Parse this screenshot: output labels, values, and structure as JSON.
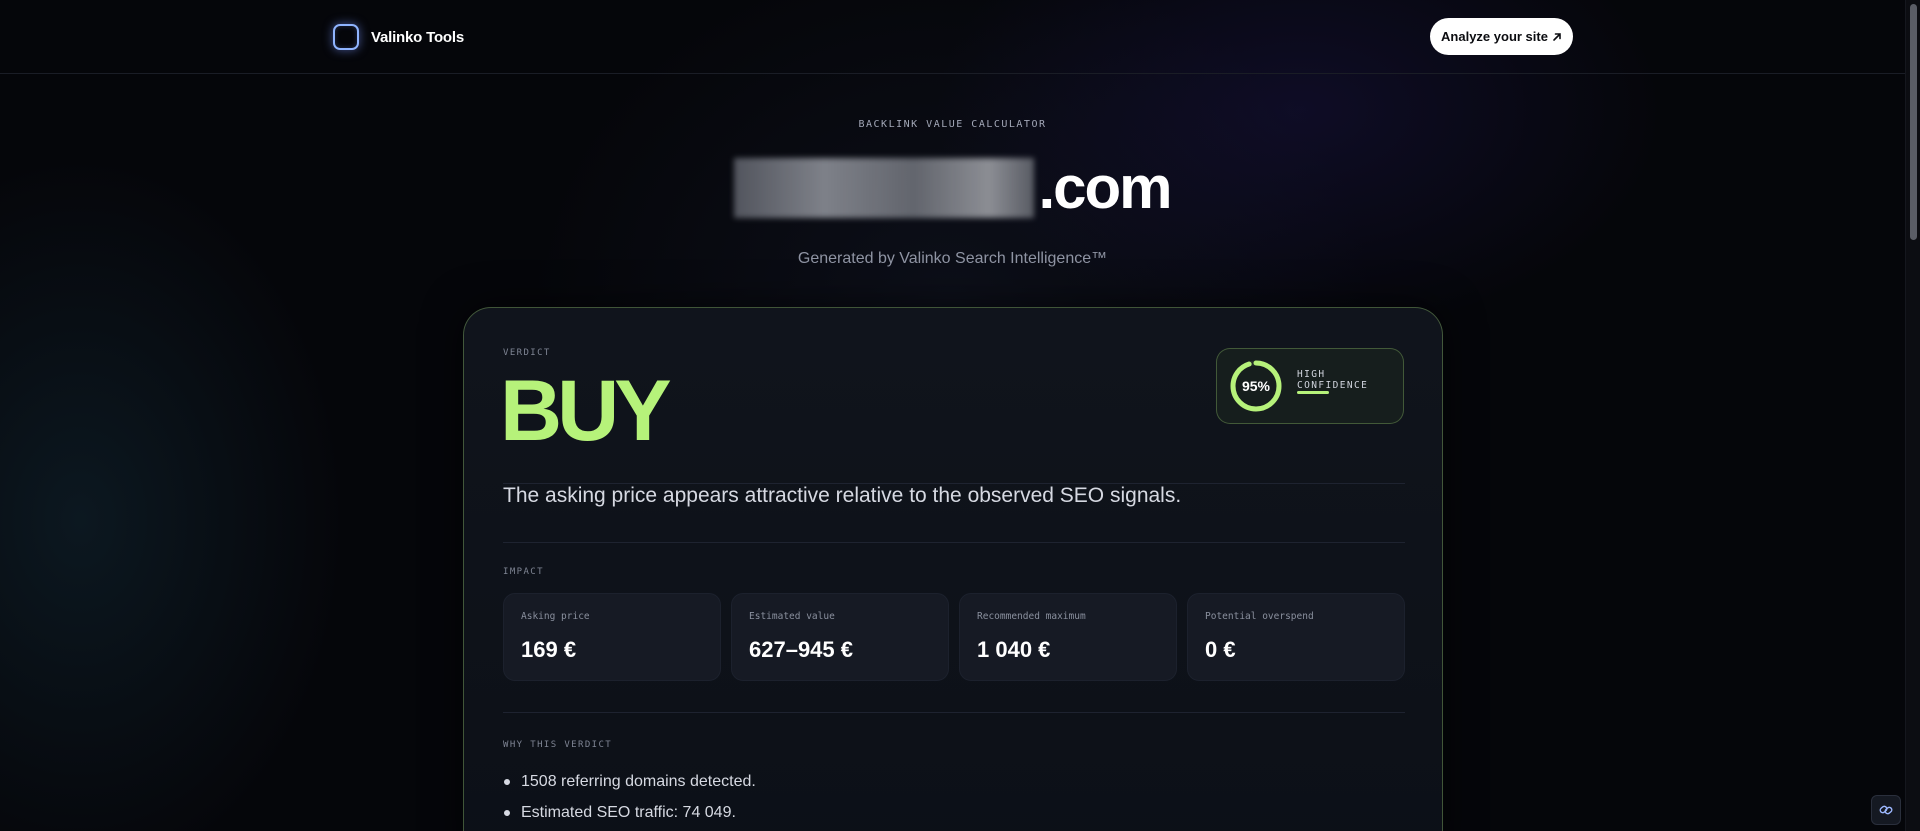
{
  "header": {
    "brand_name": "Valinko Tools",
    "cta_label": "Analyze your site",
    "cta_icon": "arrow-up-right-icon"
  },
  "hero": {
    "eyebrow": "BACKLINK VALUE CALCULATOR",
    "domain_tld": ".com",
    "subtitle": "Generated by Valinko Search Intelligence™"
  },
  "verdict": {
    "label": "VERDICT",
    "value": "BUY",
    "summary": "The asking price appears attractive relative to the observed SEO signals.",
    "confidence": {
      "percent_text": "95%",
      "fraction": 0.95,
      "label": "HIGH CONFIDENCE"
    }
  },
  "impact": {
    "label": "IMPACT",
    "metrics": [
      {
        "label": "Asking price",
        "value": "169 €"
      },
      {
        "label": "Estimated value",
        "value": "627–945 €"
      },
      {
        "label": "Recommended maximum",
        "value": "1 040 €"
      },
      {
        "label": "Potential overspend",
        "value": "0 €"
      }
    ]
  },
  "why": {
    "label": "WHY THIS VERDICT",
    "reasons": [
      "1508 referring domains detected.",
      "Estimated SEO traffic: 74 049."
    ]
  },
  "colors": {
    "accent": "#b6f27a",
    "background": "#05060a",
    "card": "#10141c"
  }
}
